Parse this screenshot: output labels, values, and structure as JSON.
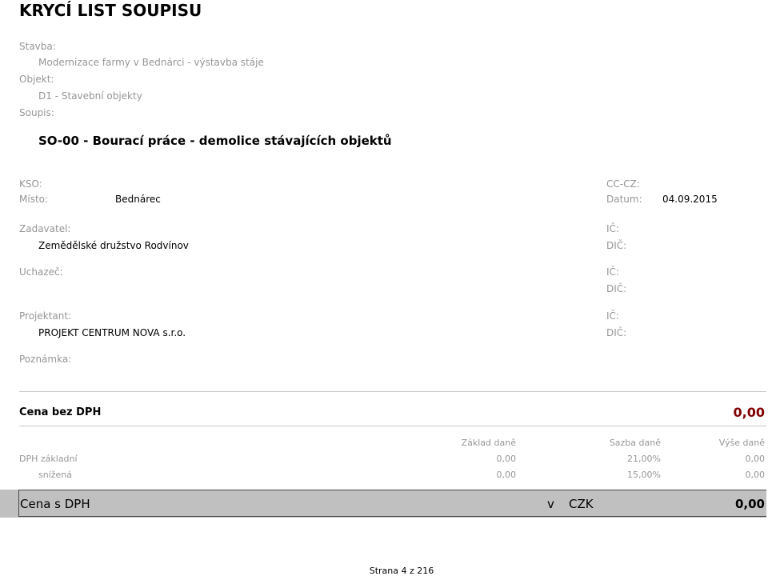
{
  "header": {
    "title": "KRYCÍ LIST SOUPISU"
  },
  "stavba": {
    "label": "Stavba:",
    "value": "Modernizace farmy v Bednárci - výstavba stáje"
  },
  "objekt": {
    "label": "Objekt:",
    "value": "D1 - Stavební objekty"
  },
  "soupis": {
    "label": "Soupis:",
    "value": "SO-00 - Bourací práce - demolice stávajících objektů"
  },
  "kso": {
    "label": "KSO:"
  },
  "cc_cz": {
    "label": "CC-CZ:"
  },
  "misto": {
    "label": "Místo:",
    "value": "Bednárec"
  },
  "datum": {
    "label": "Datum:",
    "value": "04.09.2015"
  },
  "zadavatel": {
    "label": "Zadavatel:",
    "value": "Zemědělské družstvo Rodvínov",
    "ic_label": "IČ:",
    "dic_label": "DIČ:"
  },
  "uchazec": {
    "label": "Uchazeč:",
    "ic_label": "IČ:",
    "dic_label": "DIČ:"
  },
  "projektant": {
    "label": "Projektant:",
    "value": "PROJEKT CENTRUM NOVA s.r.o.",
    "ic_label": "IČ:",
    "dic_label": "DIČ:"
  },
  "poznamka": {
    "label": "Poznámka:"
  },
  "cena_bez_dph": {
    "label": "Cena bez DPH",
    "value": "0,00"
  },
  "dph_table": {
    "headers": {
      "zaklad": "Základ daně",
      "sazba": "Sazba daně",
      "vyse": "Výše daně"
    },
    "rows": [
      {
        "label": "DPH základní",
        "zaklad": "0,00",
        "sazba": "21,00%",
        "vyse": "0,00"
      },
      {
        "label": "snížená",
        "zaklad": "0,00",
        "sazba": "15,00%",
        "vyse": "0,00"
      }
    ]
  },
  "cena_s_dph": {
    "label": "Cena s DPH",
    "v": "v",
    "currency": "CZK",
    "value": "0,00"
  },
  "footer": {
    "page": "Strana 4 z 216"
  },
  "colors": {
    "label_gray": "#969696",
    "price_red": "#800000",
    "total_bg": "#c0c0c0"
  }
}
